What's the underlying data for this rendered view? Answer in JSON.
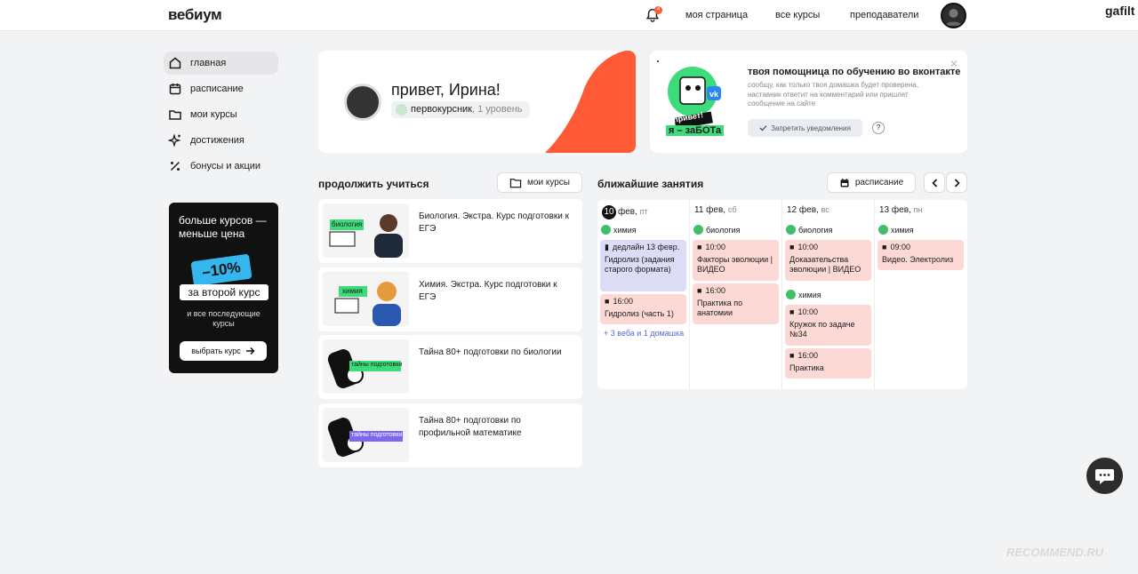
{
  "header": {
    "logo": "вебиум",
    "notifications_count": "4",
    "nav": [
      "моя страница",
      "все курсы",
      "преподаватели"
    ],
    "username": "gafilt"
  },
  "sidebar": {
    "items": [
      {
        "label": "главная",
        "icon": "home-icon"
      },
      {
        "label": "расписание",
        "icon": "calendar-icon"
      },
      {
        "label": "мои курсы",
        "icon": "folder-icon"
      },
      {
        "label": "достижения",
        "icon": "sparkle-icon"
      },
      {
        "label": "бонусы и акции",
        "icon": "percent-icon"
      }
    ]
  },
  "promo": {
    "title": "больше курсов — меньше цена",
    "discount": "–10%",
    "tag": "за второй курс",
    "sub": "и все последующие курсы",
    "button": "выбрать курс"
  },
  "hello": {
    "greeting": "привет, Ирина!",
    "level_name": "первокурсник",
    "level": ", 1 уровень"
  },
  "bot": {
    "title": "твоя помощница по обучению во вконтакте",
    "desc": "сообщу, как только твоя домашка будет проверена, наставник ответит на комментарий или пришлет сообщение на сайте",
    "button": "Запретить уведомления",
    "art_line1": "привет!",
    "art_line2": "я – заБОТа"
  },
  "continue": {
    "title": "продолжить учиться",
    "button": "мои курсы",
    "courses": [
      {
        "title": "Биология. Экстра. Курс подготовки к ЕГЭ",
        "tag": "биология"
      },
      {
        "title": "Химия. Экстра. Курс подготовки к ЕГЭ",
        "tag": "химия"
      },
      {
        "title": "Тайна 80+ подготовки по биологии",
        "tag": "тайны подготовки"
      },
      {
        "title": "Тайна 80+ подготовки по профильной математике",
        "tag": "тайны подготовки"
      }
    ]
  },
  "schedule": {
    "title": "ближайшие занятия",
    "button": "расписание",
    "days": [
      {
        "num": "10",
        "month": "фев,",
        "dow": "пт"
      },
      {
        "num": "11",
        "month": "фев,",
        "dow": "сб"
      },
      {
        "num": "12",
        "month": "фев,",
        "dow": "вс"
      },
      {
        "num": "13",
        "month": "фев,",
        "dow": "пн"
      }
    ],
    "d1": {
      "subject": "химия",
      "e1_time": "дедлайн 13 февр.",
      "e1_text": "Гидролиз (задания старого формата)",
      "e2_time": "16:00",
      "e2_text": "Гидролиз (часть 1)",
      "more": "+ 3 веба и 1 домашка"
    },
    "d2": {
      "subject": "биология",
      "e1_time": "10:00",
      "e1_text": "Факторы эволюции | ВИДЕО",
      "e2_time": "16:00",
      "e2_text": "Практика по анатомии"
    },
    "d3": {
      "subject": "биология",
      "e1_time": "10:00",
      "e1_text": "Доказательства эволюции | ВИДЕО",
      "subject2": "химия",
      "e2_time": "10:00",
      "e2_text": "Кружок по задаче №34",
      "e3_time": "16:00",
      "e3_text": "Практика"
    },
    "d4": {
      "subject": "химия",
      "e1_time": "09:00",
      "e1_text": "Видео. Электролиз"
    }
  },
  "watermark": "RECOMMEND.RU"
}
